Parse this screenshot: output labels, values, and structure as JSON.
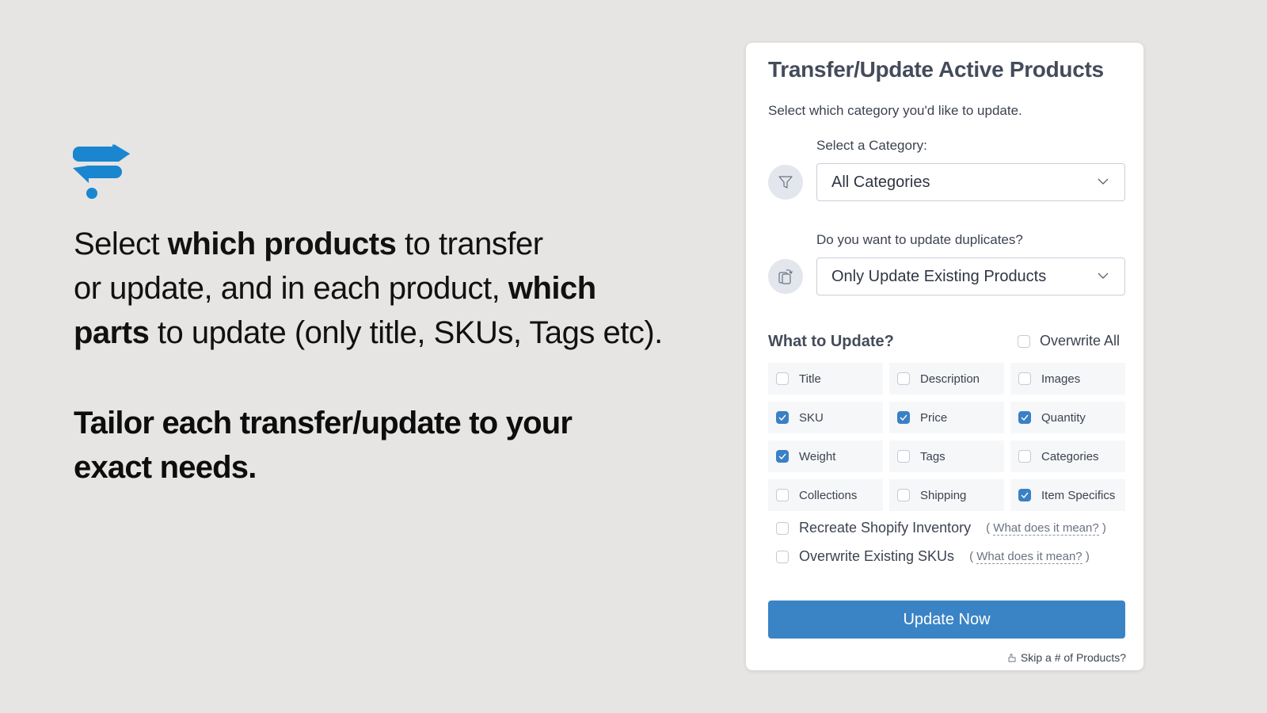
{
  "promo": {
    "headline_parts": [
      {
        "text": "Select ",
        "bold": false
      },
      {
        "text": "which products",
        "bold": true
      },
      {
        "text": " to transfer",
        "bold": false
      },
      {
        "br": true
      },
      {
        "text": "or update, and in each product, ",
        "bold": false
      },
      {
        "text": "which",
        "bold": true
      },
      {
        "br": true
      },
      {
        "text": "parts",
        "bold": true
      },
      {
        "text": " to update (only title, SKUs, Tags etc).",
        "bold": false
      }
    ],
    "tagline_line1": "Tailor each transfer/update to your",
    "tagline_line2": "exact needs.",
    "logo_color": "#1a86d0"
  },
  "card": {
    "title": "Transfer/Update Active Products",
    "subtitle": "Select which category you'd like to update.",
    "category": {
      "label": "Select a Category:",
      "value": "All Categories",
      "icon": "filter-icon"
    },
    "duplicates": {
      "label": "Do you want to update duplicates?",
      "value": "Only Update Existing Products",
      "icon": "copy-refresh-icon"
    },
    "what_to_update": {
      "title": "What to Update?",
      "overwrite_all": {
        "label": "Overwrite All",
        "checked": false
      },
      "options": [
        {
          "label": "Title",
          "checked": false
        },
        {
          "label": "Description",
          "checked": false
        },
        {
          "label": "Images",
          "checked": false
        },
        {
          "label": "SKU",
          "checked": true
        },
        {
          "label": "Price",
          "checked": true
        },
        {
          "label": "Quantity",
          "checked": true
        },
        {
          "label": "Weight",
          "checked": true
        },
        {
          "label": "Tags",
          "checked": false
        },
        {
          "label": "Categories",
          "checked": false
        },
        {
          "label": "Collections",
          "checked": false
        },
        {
          "label": "Shipping",
          "checked": false
        },
        {
          "label": "Item Specifics",
          "checked": true
        }
      ]
    },
    "extras": [
      {
        "label": "Recreate Shopify Inventory",
        "checked": false,
        "help_open": "(",
        "help_link": "What does it mean?",
        "help_close": ")"
      },
      {
        "label": "Overwrite Existing SKUs",
        "checked": false,
        "help_open": "(",
        "help_link": "What does it mean?",
        "help_close": ")"
      }
    ],
    "update_button": "Update Now",
    "skip_link": "Skip a # of Products?",
    "accent_color": "#3a84c6"
  }
}
